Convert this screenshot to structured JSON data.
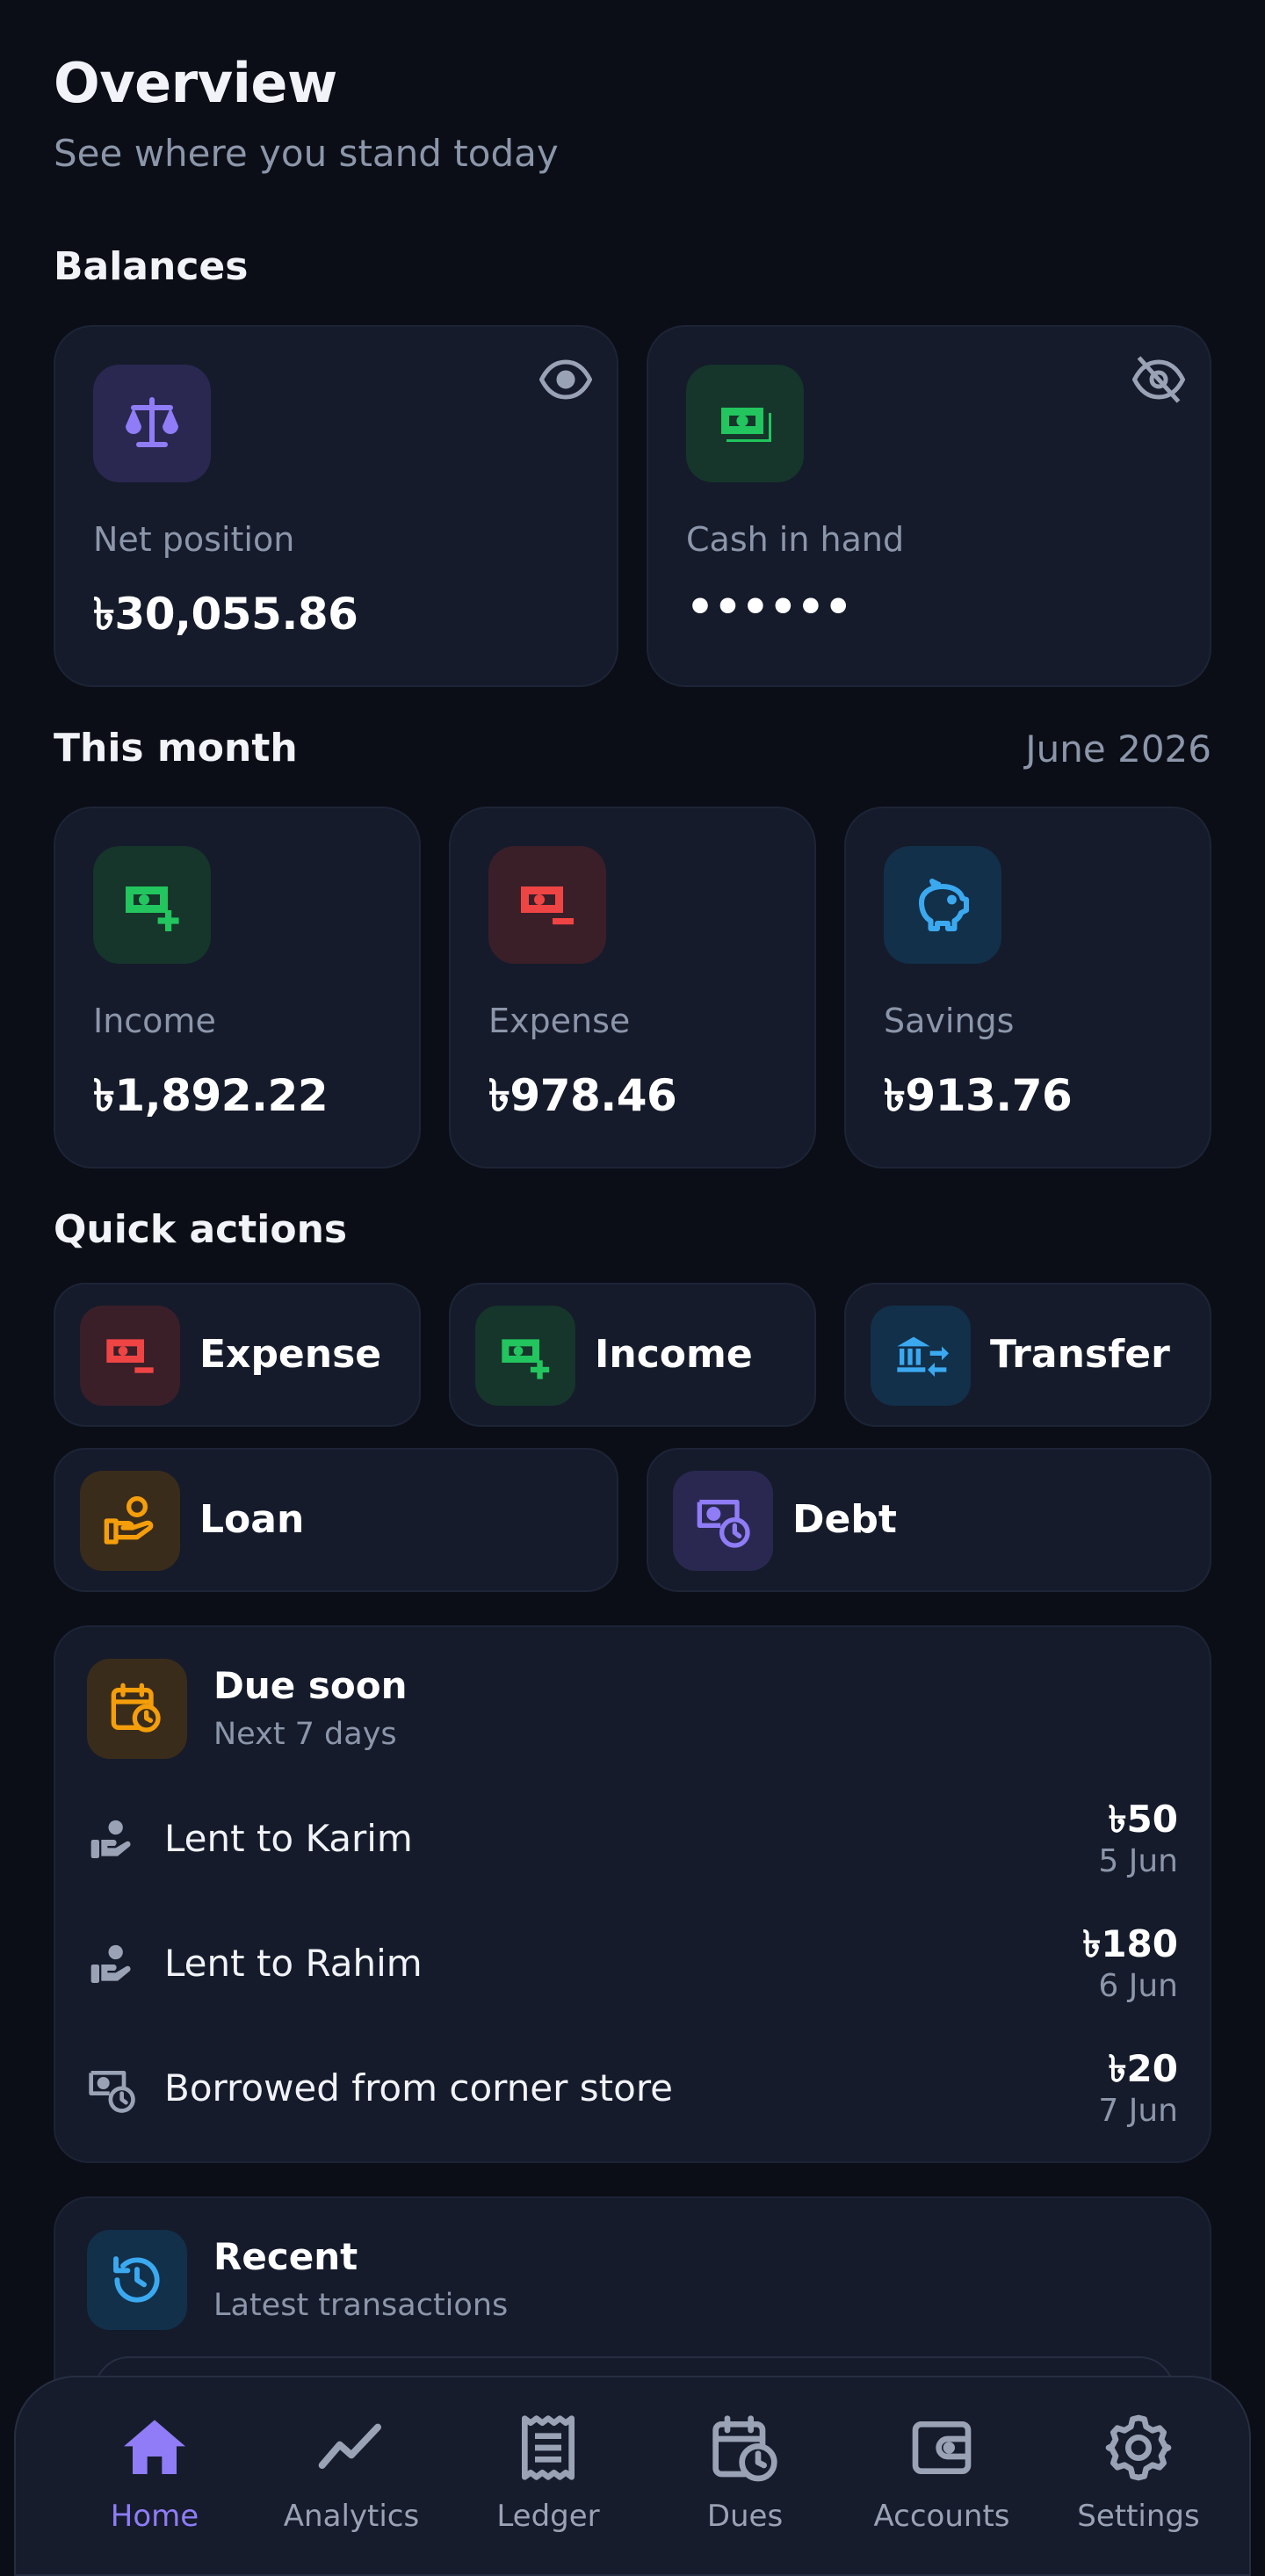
{
  "header": {
    "title": "Overview",
    "subtitle": "See where you stand today"
  },
  "balances": {
    "section_title": "Balances",
    "cards": [
      {
        "label": "Net position",
        "value": "৳30,055.86",
        "icon": "scale-icon",
        "visibility_icon": "eye-icon"
      },
      {
        "label": "Cash in hand",
        "value": "••••••",
        "icon": "cash-icon",
        "visibility_icon": "eye-off-icon"
      }
    ]
  },
  "this_month": {
    "section_title": "This month",
    "period": "June 2026",
    "cards": [
      {
        "label": "Income",
        "value": "৳1,892.22",
        "icon": "cash-plus-icon"
      },
      {
        "label": "Expense",
        "value": "৳978.46",
        "icon": "cash-minus-icon"
      },
      {
        "label": "Savings",
        "value": "৳913.76",
        "icon": "piggy-bank-icon"
      }
    ]
  },
  "quick_actions": {
    "section_title": "Quick actions",
    "items": [
      {
        "label": "Expense",
        "icon": "cash-minus-icon"
      },
      {
        "label": "Income",
        "icon": "cash-plus-icon"
      },
      {
        "label": "Transfer",
        "icon": "bank-transfer-icon"
      },
      {
        "label": "Loan",
        "icon": "hand-coin-icon"
      },
      {
        "label": "Debt",
        "icon": "cash-clock-icon"
      }
    ]
  },
  "due_soon": {
    "title": "Due soon",
    "subtitle": "Next 7 days",
    "items": [
      {
        "label": "Lent to Karim",
        "amount": "৳50",
        "date": "5 Jun",
        "icon": "hand-person-icon"
      },
      {
        "label": "Lent to Rahim",
        "amount": "৳180",
        "date": "6 Jun",
        "icon": "hand-person-icon"
      },
      {
        "label": "Borrowed from corner store",
        "amount": "৳20",
        "date": "7 Jun",
        "icon": "cash-clock-icon"
      }
    ]
  },
  "recent": {
    "title": "Recent",
    "subtitle": "Latest transactions"
  },
  "nav": {
    "items": [
      {
        "label": "Home",
        "icon": "home-icon",
        "active": true
      },
      {
        "label": "Analytics",
        "icon": "trend-icon"
      },
      {
        "label": "Ledger",
        "icon": "receipt-icon"
      },
      {
        "label": "Dues",
        "icon": "calendar-clock-icon"
      },
      {
        "label": "Accounts",
        "icon": "wallet-icon"
      },
      {
        "label": "Settings",
        "icon": "gear-icon"
      }
    ]
  },
  "colors": {
    "background": "#0b0e16",
    "card": "#151b2b",
    "accent_purple": "#8f7cf6",
    "green": "#22c55e",
    "red": "#ef4444",
    "blue": "#3ba9f0",
    "orange": "#f59e0b",
    "muted_text": "#8c96aa"
  }
}
